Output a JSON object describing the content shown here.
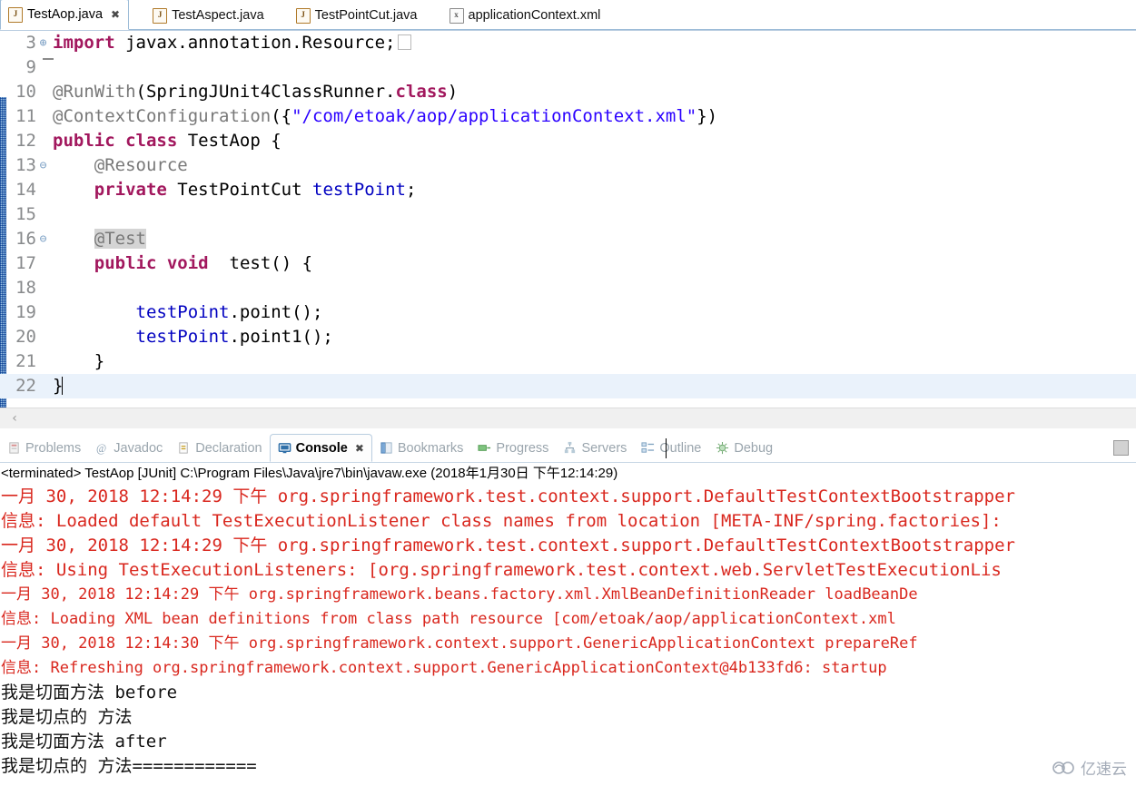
{
  "editor_tabs": [
    {
      "label": "TestAop.java",
      "icon": "java-file-icon",
      "icon_glyph": "J",
      "active": true,
      "closable": true,
      "close_glyph": "✖"
    },
    {
      "label": "TestAspect.java",
      "icon": "java-file-icon",
      "icon_glyph": "J",
      "active": false,
      "closable": false
    },
    {
      "label": "TestPointCut.java",
      "icon": "java-file-icon",
      "icon_glyph": "J",
      "active": false,
      "closable": false
    },
    {
      "label": "applicationContext.xml",
      "icon": "xml-file-icon",
      "icon_glyph": "x",
      "active": false,
      "closable": false
    }
  ],
  "code": {
    "lines": [
      {
        "num": "3",
        "fold": "⊕",
        "current": false,
        "tokens": [
          {
            "t": "import",
            "c": "k"
          },
          {
            "t": " javax.annotation.Resource;",
            "c": "pl"
          }
        ],
        "trailing": "ghostbox"
      },
      {
        "num": "9",
        "fold": "",
        "current": false,
        "tokens": []
      },
      {
        "num": "10",
        "fold": "",
        "current": false,
        "tokens": [
          {
            "t": "@RunWith",
            "c": "ann"
          },
          {
            "t": "(SpringJUnit4ClassRunner.",
            "c": "pl"
          },
          {
            "t": "class",
            "c": "k"
          },
          {
            "t": ")",
            "c": "pl"
          }
        ]
      },
      {
        "num": "11",
        "fold": "",
        "current": false,
        "tokens": [
          {
            "t": "@ContextConfiguration",
            "c": "ann"
          },
          {
            "t": "({",
            "c": "pl"
          },
          {
            "t": "\"/com/etoak/aop/applicationContext.xml\"",
            "c": "str"
          },
          {
            "t": "})",
            "c": "pl"
          }
        ]
      },
      {
        "num": "12",
        "fold": "",
        "current": false,
        "tokens": [
          {
            "t": "public",
            "c": "k"
          },
          {
            "t": " ",
            "c": "pl"
          },
          {
            "t": "class",
            "c": "k"
          },
          {
            "t": " TestAop {",
            "c": "pl"
          }
        ]
      },
      {
        "num": "13",
        "fold": "⊖",
        "current": false,
        "tokens": [
          {
            "t": "    @Resource",
            "c": "ann"
          }
        ]
      },
      {
        "num": "14",
        "fold": "",
        "current": false,
        "tokens": [
          {
            "t": "    ",
            "c": "pl"
          },
          {
            "t": "private",
            "c": "k"
          },
          {
            "t": " TestPointCut ",
            "c": "pl"
          },
          {
            "t": "testPoint",
            "c": "fld"
          },
          {
            "t": ";",
            "c": "pl"
          }
        ]
      },
      {
        "num": "15",
        "fold": "",
        "current": false,
        "tokens": []
      },
      {
        "num": "16",
        "fold": "⊖",
        "current": false,
        "tokens": [
          {
            "t": "    ",
            "c": "pl"
          },
          {
            "t": "@Test",
            "c": "ann hl"
          }
        ]
      },
      {
        "num": "17",
        "fold": "",
        "current": false,
        "tokens": [
          {
            "t": "    ",
            "c": "pl"
          },
          {
            "t": "public",
            "c": "k"
          },
          {
            "t": " ",
            "c": "pl"
          },
          {
            "t": "void",
            "c": "k"
          },
          {
            "t": "  test() {",
            "c": "pl"
          }
        ]
      },
      {
        "num": "18",
        "fold": "",
        "current": false,
        "tokens": []
      },
      {
        "num": "19",
        "fold": "",
        "current": false,
        "tokens": [
          {
            "t": "        ",
            "c": "pl"
          },
          {
            "t": "testPoint",
            "c": "fld"
          },
          {
            "t": ".point();",
            "c": "pl"
          }
        ]
      },
      {
        "num": "20",
        "fold": "",
        "current": false,
        "tokens": [
          {
            "t": "        ",
            "c": "pl"
          },
          {
            "t": "testPoint",
            "c": "fld"
          },
          {
            "t": ".point1();",
            "c": "pl"
          }
        ]
      },
      {
        "num": "21",
        "fold": "",
        "current": false,
        "tokens": [
          {
            "t": "    }",
            "c": "pl"
          }
        ]
      },
      {
        "num": "22",
        "fold": "",
        "current": true,
        "tokens": [
          {
            "t": "}",
            "c": "pl"
          }
        ],
        "trailing": "caret"
      }
    ]
  },
  "editor_scrollbar": {
    "left_arrow_glyph": "‹"
  },
  "view_tabs": [
    {
      "label": "Problems",
      "icon": "problems-icon",
      "active": false
    },
    {
      "label": "Javadoc",
      "icon": "javadoc-icon",
      "active": false
    },
    {
      "label": "Declaration",
      "icon": "declaration-icon",
      "active": false
    },
    {
      "label": "Console",
      "icon": "console-icon",
      "active": true,
      "close_glyph": "✖"
    },
    {
      "label": "Bookmarks",
      "icon": "bookmarks-icon",
      "active": false
    },
    {
      "label": "Progress",
      "icon": "progress-icon",
      "active": false
    },
    {
      "label": "Servers",
      "icon": "servers-icon",
      "active": false
    },
    {
      "label": "Outline",
      "icon": "outline-icon",
      "active": false
    },
    {
      "label": "Debug",
      "icon": "debug-icon",
      "active": false
    }
  ],
  "console": {
    "process_line": "<terminated> TestAop [JUnit] C:\\Program Files\\Java\\jre7\\bin\\javaw.exe (2018年1月30日 下午12:14:29)",
    "lines": [
      {
        "text": "一月 30, 2018 12:14:29 下午 org.springframework.test.context.support.DefaultTestContextBootstrapper",
        "style": "log"
      },
      {
        "text": "信息: Loaded default TestExecutionListener class names from location [META-INF/spring.factories]:",
        "style": "log"
      },
      {
        "text": "一月 30, 2018 12:14:29 下午 org.springframework.test.context.support.DefaultTestContextBootstrapper",
        "style": "log"
      },
      {
        "text": "信息: Using TestExecutionListeners: [org.springframework.test.context.web.ServletTestExecutionLis",
        "style": "log"
      },
      {
        "text": "一月 30, 2018 12:14:29 下午 org.springframework.beans.factory.xml.XmlBeanDefinitionReader loadBeanDe",
        "style": "log-small"
      },
      {
        "text": "信息: Loading XML bean definitions from class path resource [com/etoak/aop/applicationContext.xml",
        "style": "log-small"
      },
      {
        "text": "一月 30, 2018 12:14:30 下午 org.springframework.context.support.GenericApplicationContext prepareRef",
        "style": "log-small"
      },
      {
        "text": "信息: Refreshing org.springframework.context.support.GenericApplicationContext@4b133fd6: startup ",
        "style": "log-small"
      },
      {
        "text": "我是切面方法 before",
        "style": "out"
      },
      {
        "text": "我是切点的 方法",
        "style": "out"
      },
      {
        "text": "我是切面方法 after",
        "style": "out"
      },
      {
        "text": "我是切点的 方法============",
        "style": "out"
      }
    ]
  },
  "watermark": {
    "text": "亿速云",
    "icon": "cloud-icon"
  },
  "colors": {
    "keyword": "#a2185e",
    "string": "#2a00ff",
    "field": "#0000c0",
    "annotation": "#787878",
    "console_error": "#d9271e",
    "current_line": "#eaf2fb",
    "tab_border": "#9dbcd8"
  }
}
